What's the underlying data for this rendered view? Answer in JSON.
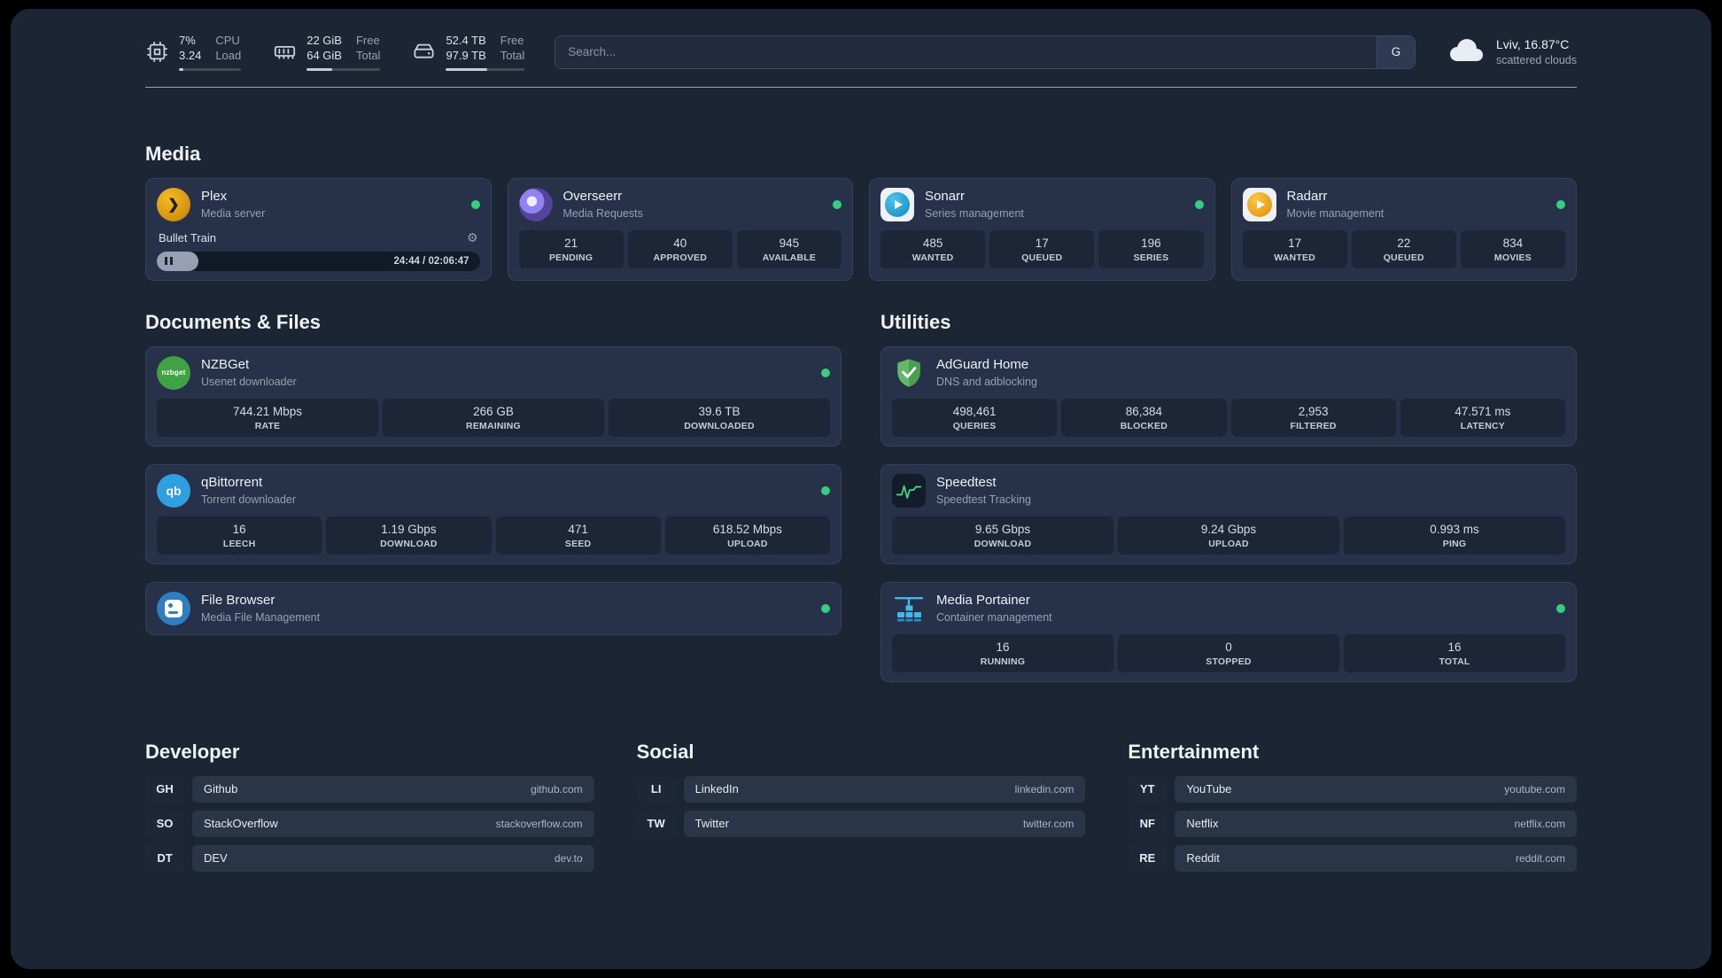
{
  "topbar": {
    "resources": [
      {
        "icon": "cpu-icon",
        "col1_top": "7%",
        "col1_bottom": "3.24",
        "col2_top": "CPU",
        "col2_bottom": "Load",
        "progress_pct": 7
      },
      {
        "icon": "memory-icon",
        "col1_top": "22 GiB",
        "col1_bottom": "64 GiB",
        "col2_top": "Free",
        "col2_bottom": "Total",
        "progress_pct": 34
      },
      {
        "icon": "disk-icon",
        "col1_top": "52.4 TB",
        "col1_bottom": "97.9 TB",
        "col2_top": "Free",
        "col2_bottom": "Total",
        "progress_pct": 53
      }
    ],
    "search": {
      "placeholder": "Search...",
      "button": "G"
    },
    "weather": {
      "location": "Lviv, 16.87°C",
      "condition": "scattered clouds"
    }
  },
  "media": {
    "title": "Media",
    "cards": [
      {
        "name": "Plex",
        "subtitle": "Media server",
        "player": {
          "track": "Bullet Train",
          "time": "24:44 / 02:06:47",
          "progress_pct": 13
        }
      },
      {
        "name": "Overseerr",
        "subtitle": "Media Requests",
        "stats": [
          {
            "value": "21",
            "label": "PENDING"
          },
          {
            "value": "40",
            "label": "APPROVED"
          },
          {
            "value": "945",
            "label": "AVAILABLE"
          }
        ]
      },
      {
        "name": "Sonarr",
        "subtitle": "Series management",
        "stats": [
          {
            "value": "485",
            "label": "WANTED"
          },
          {
            "value": "17",
            "label": "QUEUED"
          },
          {
            "value": "196",
            "label": "SERIES"
          }
        ]
      },
      {
        "name": "Radarr",
        "subtitle": "Movie management",
        "stats": [
          {
            "value": "17",
            "label": "WANTED"
          },
          {
            "value": "22",
            "label": "QUEUED"
          },
          {
            "value": "834",
            "label": "MOVIES"
          }
        ]
      }
    ]
  },
  "documents": {
    "title": "Documents & Files",
    "cards": [
      {
        "name": "NZBGet",
        "subtitle": "Usenet downloader",
        "stats": [
          {
            "value": "744.21 Mbps",
            "label": "RATE"
          },
          {
            "value": "266 GB",
            "label": "REMAINING"
          },
          {
            "value": "39.6 TB",
            "label": "DOWNLOADED"
          }
        ]
      },
      {
        "name": "qBittorrent",
        "subtitle": "Torrent downloader",
        "stats": [
          {
            "value": "16",
            "label": "LEECH"
          },
          {
            "value": "1.19 Gbps",
            "label": "DOWNLOAD"
          },
          {
            "value": "471",
            "label": "SEED"
          },
          {
            "value": "618.52 Mbps",
            "label": "UPLOAD"
          }
        ]
      },
      {
        "name": "File Browser",
        "subtitle": "Media File Management"
      }
    ]
  },
  "utilities": {
    "title": "Utilities",
    "cards": [
      {
        "name": "AdGuard Home",
        "subtitle": "DNS and adblocking",
        "stats": [
          {
            "value": "498,461",
            "label": "QUERIES"
          },
          {
            "value": "86,384",
            "label": "BLOCKED"
          },
          {
            "value": "2,953",
            "label": "FILTERED"
          },
          {
            "value": "47.571 ms",
            "label": "LATENCY"
          }
        ]
      },
      {
        "name": "Speedtest",
        "subtitle": "Speedtest Tracking",
        "stats": [
          {
            "value": "9.65 Gbps",
            "label": "DOWNLOAD"
          },
          {
            "value": "9.24 Gbps",
            "label": "UPLOAD"
          },
          {
            "value": "0.993 ms",
            "label": "PING"
          }
        ]
      },
      {
        "name": "Media Portainer",
        "subtitle": "Container management",
        "stats": [
          {
            "value": "16",
            "label": "RUNNING"
          },
          {
            "value": "0",
            "label": "STOPPED"
          },
          {
            "value": "16",
            "label": "TOTAL"
          }
        ]
      }
    ]
  },
  "bookmarks": [
    {
      "title": "Developer",
      "items": [
        {
          "abbr": "GH",
          "name": "Github",
          "domain": "github.com"
        },
        {
          "abbr": "SO",
          "name": "StackOverflow",
          "domain": "stackoverflow.com"
        },
        {
          "abbr": "DT",
          "name": "DEV",
          "domain": "dev.to"
        }
      ]
    },
    {
      "title": "Social",
      "items": [
        {
          "abbr": "LI",
          "name": "LinkedIn",
          "domain": "linkedin.com"
        },
        {
          "abbr": "TW",
          "name": "Twitter",
          "domain": "twitter.com"
        }
      ]
    },
    {
      "title": "Entertainment",
      "items": [
        {
          "abbr": "YT",
          "name": "YouTube",
          "domain": "youtube.com"
        },
        {
          "abbr": "NF",
          "name": "Netflix",
          "domain": "netflix.com"
        },
        {
          "abbr": "RE",
          "name": "Reddit",
          "domain": "reddit.com"
        }
      ]
    }
  ],
  "icons": {
    "nzbget_text": "nzbget",
    "qb_text": "qb",
    "plex_chevron": "❯",
    "gear": "⚙"
  }
}
